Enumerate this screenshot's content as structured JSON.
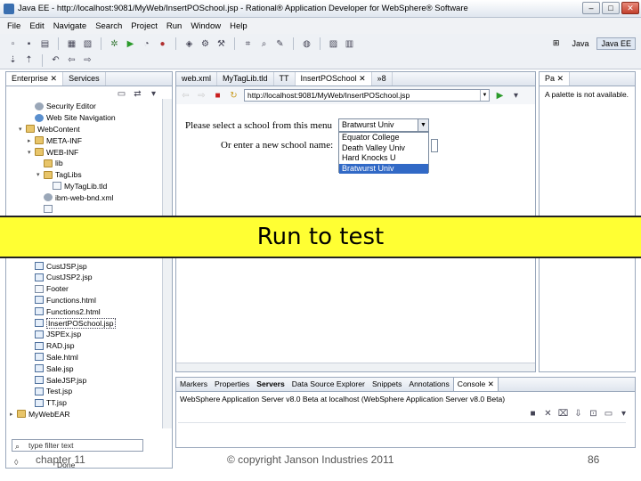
{
  "window": {
    "title": "Java EE - http://localhost:9081/MyWeb/InsertPOSchool.jsp - Rational® Application Developer for WebSphere® Software",
    "minimize": "–",
    "maximize": "□",
    "close": "✕"
  },
  "menu": [
    "File",
    "Edit",
    "Navigate",
    "Search",
    "Project",
    "Run",
    "Window",
    "Help"
  ],
  "perspectives": {
    "java": "Java",
    "javaee": "Java EE"
  },
  "left_panel": {
    "tabs": [
      {
        "label": "Enterprise ✕"
      },
      {
        "label": "Services"
      }
    ],
    "tree": [
      {
        "label": "Security Editor",
        "icon": "gear",
        "indent": 2
      },
      {
        "label": "Web Site Navigation",
        "icon": "globe",
        "indent": 2
      },
      {
        "label": "WebContent",
        "icon": "folder",
        "indent": 1,
        "twisty": "▾"
      },
      {
        "label": "META-INF",
        "icon": "folder",
        "indent": 2,
        "twisty": "▸"
      },
      {
        "label": "WEB-INF",
        "icon": "folder",
        "indent": 2,
        "twisty": "▾"
      },
      {
        "label": "lib",
        "icon": "folder",
        "indent": 3
      },
      {
        "label": "TagLibs",
        "icon": "folder",
        "indent": 3,
        "twisty": "▾"
      },
      {
        "label": "MyTagLib.tld",
        "icon": "file",
        "indent": 4
      },
      {
        "label": "ibm-web-bnd.xml",
        "icon": "gear",
        "indent": 3
      },
      {
        "label": "",
        "icon": "file",
        "indent": 3
      },
      {
        "label": "",
        "icon": "file",
        "indent": 3
      },
      {
        "label": "",
        "icon": "file",
        "indent": 3
      },
      {
        "label": "",
        "icon": "file",
        "indent": 3
      },
      {
        "label": "",
        "icon": "file",
        "indent": 2
      },
      {
        "label": "CustJSP.jsp",
        "icon": "jsp",
        "indent": 2
      },
      {
        "label": "CustJSP2.jsp",
        "icon": "jsp",
        "indent": 2
      },
      {
        "label": "Footer",
        "icon": "file",
        "indent": 2
      },
      {
        "label": "Functions.html",
        "icon": "jsp",
        "indent": 2
      },
      {
        "label": "Functions2.html",
        "icon": "jsp",
        "indent": 2
      },
      {
        "label": "InsertPOSchool.jsp",
        "icon": "jsp",
        "indent": 2,
        "selected": true
      },
      {
        "label": "JSPEx.jsp",
        "icon": "jsp",
        "indent": 2
      },
      {
        "label": "RAD.jsp",
        "icon": "jsp",
        "indent": 2
      },
      {
        "label": "Sale.html",
        "icon": "jsp",
        "indent": 2
      },
      {
        "label": "Sale.jsp",
        "icon": "jsp",
        "indent": 2
      },
      {
        "label": "SaleJSP.jsp",
        "icon": "jsp",
        "indent": 2
      },
      {
        "label": "Test.jsp",
        "icon": "jsp",
        "indent": 2
      },
      {
        "label": "TT.jsp",
        "icon": "jsp",
        "indent": 2
      },
      {
        "label": "MyWebEAR",
        "icon": "folder",
        "indent": 0,
        "twisty": "▸"
      }
    ],
    "filter_placeholder": "type filter text"
  },
  "editor": {
    "tabs": [
      {
        "label": "web.xml"
      },
      {
        "label": "MyTagLib.tld"
      },
      {
        "label": "TT"
      },
      {
        "label": "InsertPOSchool ✕",
        "active": true
      },
      {
        "label": "»8"
      }
    ],
    "url": "http://localhost:9081/MyWeb/InsertPOSchool.jsp",
    "page": {
      "prompt_select": "Please select a school from this menu",
      "prompt_new": "Or enter a new school name:",
      "selected_value": "Bratwurst Univ",
      "options": [
        "Equator College",
        "Death Valley Univ",
        "Hard Knocks U",
        "Bratwurst Univ"
      ],
      "highlighted_index": 3
    }
  },
  "palette": {
    "tab": "Pa ✕",
    "message": "A palette is not available."
  },
  "bottom_panel": {
    "tabs": [
      {
        "label": "Markers"
      },
      {
        "label": "Properties"
      },
      {
        "label": "Servers",
        "bold": true
      },
      {
        "label": "Data Source Explorer"
      },
      {
        "label": "Snippets"
      },
      {
        "label": "Annotations"
      },
      {
        "label": "Console ✕",
        "active": true
      }
    ],
    "server_line": "WebSphere Application Server v8.0 Beta at localhost (WebSphere Application Server v8.0 Beta)"
  },
  "banner": {
    "text": "Run to test"
  },
  "footer": {
    "chapter": "chapter 11",
    "status": "Done",
    "copyright": "© copyright Janson Industries 2011",
    "page": "86"
  },
  "colors": {
    "banner": "#ffff33",
    "highlight": "#3169c6"
  }
}
